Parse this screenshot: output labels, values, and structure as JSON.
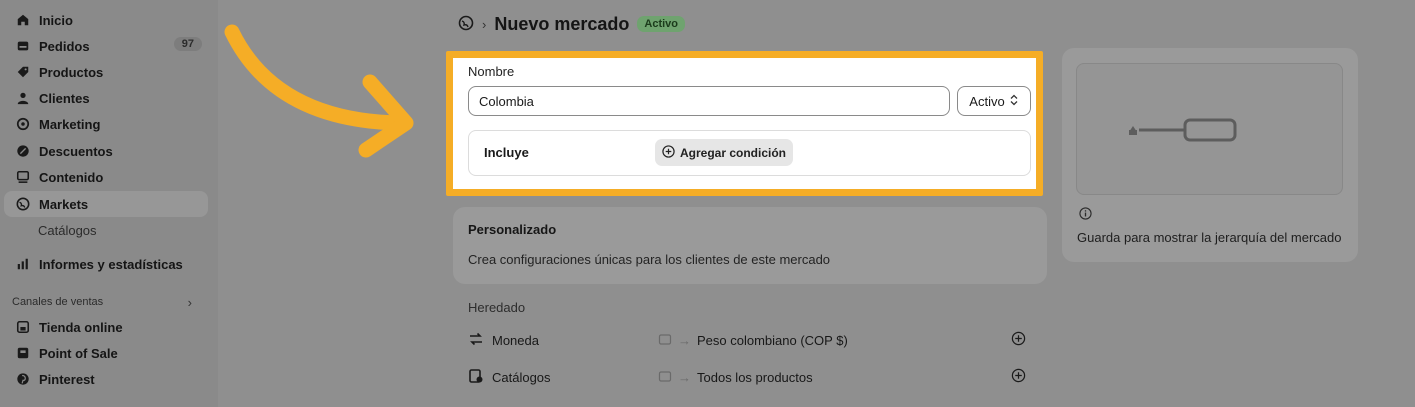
{
  "sidebar": {
    "items": [
      {
        "label": "Inicio",
        "icon": "home-icon"
      },
      {
        "label": "Pedidos",
        "icon": "orders-icon",
        "badge": "97"
      },
      {
        "label": "Productos",
        "icon": "tag-icon"
      },
      {
        "label": "Clientes",
        "icon": "person-icon"
      },
      {
        "label": "Marketing",
        "icon": "target-icon"
      },
      {
        "label": "Descuentos",
        "icon": "discount-icon"
      },
      {
        "label": "Contenido",
        "icon": "content-icon"
      },
      {
        "label": "Markets",
        "icon": "globe-icon"
      }
    ],
    "sub_item": "Catálogos",
    "reports": {
      "label": "Informes y estadísticas",
      "icon": "bar-chart-icon"
    },
    "sales_channels_title": "Canales de ventas",
    "channels": [
      {
        "label": "Tienda online",
        "icon": "store-icon"
      },
      {
        "label": "Point of Sale",
        "icon": "pos-icon"
      },
      {
        "label": "Pinterest",
        "icon": "pinterest-icon"
      }
    ]
  },
  "header": {
    "title": "Nuevo mercado",
    "status": "Activo"
  },
  "name_card": {
    "label": "Nombre",
    "value": "Colombia",
    "status_select": "Activo",
    "includes_label": "Incluye",
    "add_condition": "Agregar condición"
  },
  "custom_card": {
    "title": "Personalizado",
    "description": "Crea configuraciones únicas para los clientes de este mercado"
  },
  "inherited": {
    "label": "Heredado",
    "rows": [
      {
        "name": "Moneda",
        "value": "Peso colombiano (COP $)"
      },
      {
        "name": "Catálogos",
        "value": "Todos los productos"
      }
    ]
  },
  "right_panel": {
    "info_text": "Guarda para mostrar la jerarquía del mercado"
  },
  "colors": {
    "highlight": "#f5ad26",
    "arrow": "#f5ad26",
    "status_green": "#6fa36f"
  }
}
